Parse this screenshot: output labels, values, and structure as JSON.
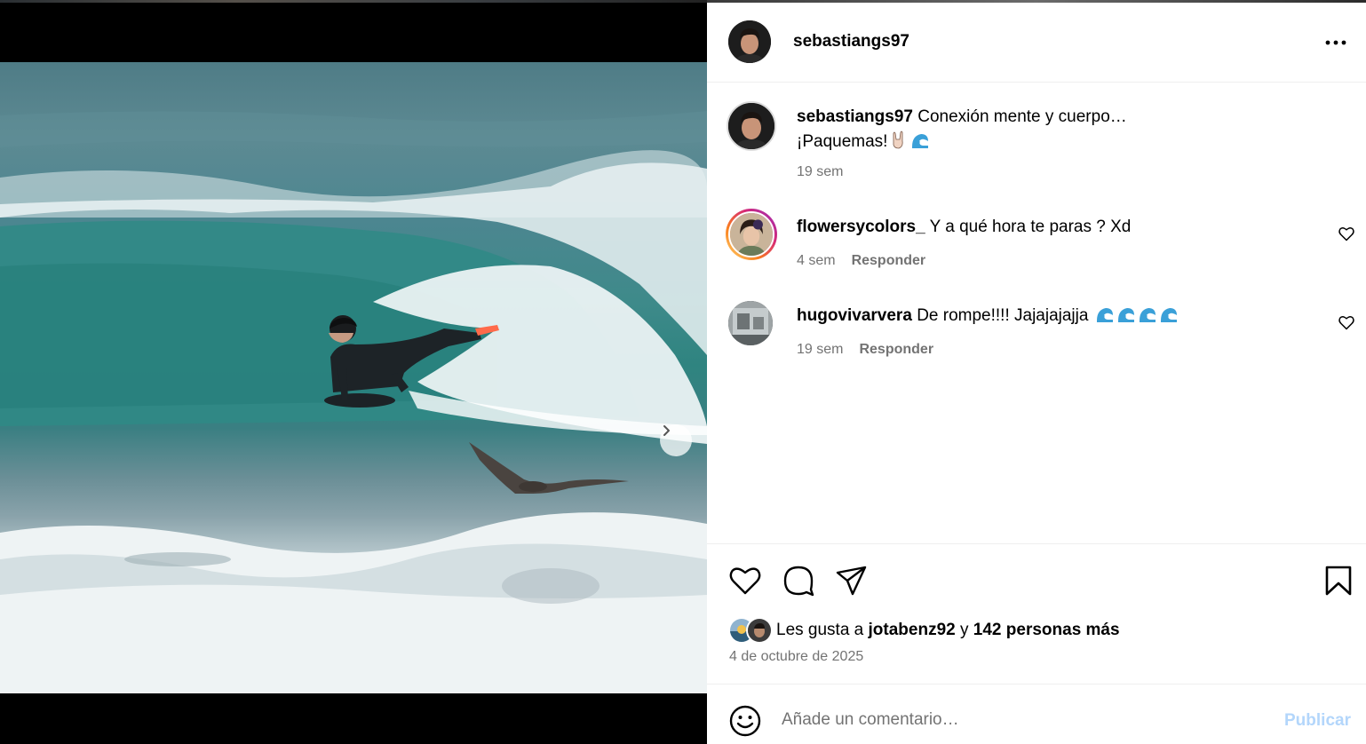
{
  "post": {
    "author": "sebastiangs97",
    "caption_line1": "Conexión mente y cuerpo…",
    "caption_line2": "¡Paquemas!",
    "caption_time": "19 sem"
  },
  "comments": [
    {
      "user": "flowersycolors_",
      "text": "Y a qué hora te paras ? Xd",
      "time": "4 sem",
      "reply": "Responder"
    },
    {
      "user": "hugovivarvera",
      "text": "De rompe!!!! Jajajajajja",
      "time": "19 sem",
      "reply": "Responder"
    }
  ],
  "likes": {
    "prefix": "Les gusta a",
    "user": "jotabenz92",
    "joiner": "y",
    "others": "142 personas más"
  },
  "date": "4 de octubre de 2025",
  "composer": {
    "placeholder": "Añade un comentario…",
    "publish_label": "Publicar"
  },
  "icons": {
    "more": "more-horizontal-icon",
    "like": "heart-icon",
    "comment": "comment-bubble-icon",
    "share": "paper-plane-icon",
    "save": "bookmark-icon",
    "emoji": "smiley-icon",
    "next": "chevron-right-icon",
    "wave_emoji": "wave-emoji",
    "rock_emoji": "sign-of-horns-emoji"
  },
  "colors": {
    "accent_disabled": "#b3d6fb",
    "secondary_text": "#737373",
    "divider": "#efefef"
  }
}
